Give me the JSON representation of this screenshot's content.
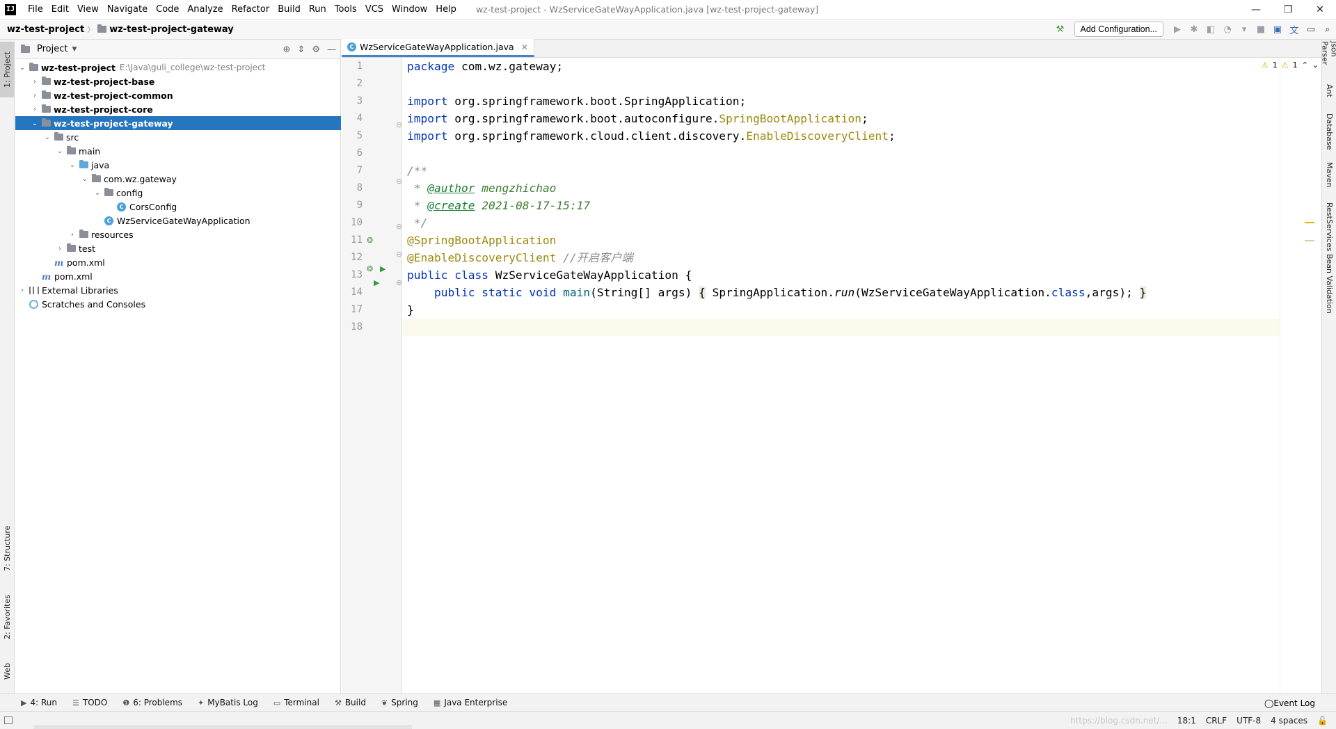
{
  "menubar": {
    "logo": "IJ",
    "items": [
      "File",
      "Edit",
      "View",
      "Navigate",
      "Code",
      "Analyze",
      "Refactor",
      "Build",
      "Run",
      "Tools",
      "VCS",
      "Window",
      "Help"
    ],
    "window_title": "wz-test-project - WzServiceGateWayApplication.java [wz-test-project-gateway]"
  },
  "navbar": {
    "crumbs": [
      "wz-test-project",
      "wz-test-project-gateway"
    ],
    "add_config_label": "Add Configuration..."
  },
  "left_strip": {
    "tabs": [
      "1: Project",
      "7: Structure",
      "2: Favorites",
      "Web"
    ]
  },
  "right_strip": {
    "tabs": [
      "Json Parser",
      "Ant",
      "Database",
      "Maven",
      "RestServices",
      "Bean Validation"
    ]
  },
  "project_panel": {
    "title": "Project",
    "tree": [
      {
        "label": "wz-test-project",
        "hint": "E:\\Java\\guli_college\\wz-test-project",
        "depth": 0,
        "chev": "v",
        "bold": true,
        "icon": "folder"
      },
      {
        "label": "wz-test-project-base",
        "depth": 1,
        "chev": ">",
        "bold": true,
        "icon": "folder"
      },
      {
        "label": "wz-test-project-common",
        "depth": 1,
        "chev": ">",
        "bold": true,
        "icon": "folder"
      },
      {
        "label": "wz-test-project-core",
        "depth": 1,
        "chev": ">",
        "bold": true,
        "icon": "folder"
      },
      {
        "label": "wz-test-project-gateway",
        "depth": 1,
        "chev": "v",
        "bold": true,
        "icon": "folder",
        "selected": true
      },
      {
        "label": "src",
        "depth": 2,
        "chev": "v",
        "icon": "folder"
      },
      {
        "label": "main",
        "depth": 3,
        "chev": "v",
        "icon": "folder"
      },
      {
        "label": "java",
        "depth": 4,
        "chev": "v",
        "icon": "folder-blue"
      },
      {
        "label": "com.wz.gateway",
        "depth": 5,
        "chev": "v",
        "icon": "folder"
      },
      {
        "label": "config",
        "depth": 6,
        "chev": "v",
        "icon": "folder"
      },
      {
        "label": "CorsConfig",
        "depth": 7,
        "chev": "",
        "icon": "class"
      },
      {
        "label": "WzServiceGateWayApplication",
        "depth": 6,
        "chev": "",
        "icon": "class"
      },
      {
        "label": "resources",
        "depth": 4,
        "chev": ">",
        "icon": "folder"
      },
      {
        "label": "test",
        "depth": 3,
        "chev": ">",
        "icon": "folder"
      },
      {
        "label": "pom.xml",
        "depth": 2,
        "chev": "",
        "icon": "maven"
      },
      {
        "label": "pom.xml",
        "depth": 1,
        "chev": "",
        "icon": "maven"
      },
      {
        "label": "External Libraries",
        "depth": 0,
        "chev": ">",
        "icon": "lib"
      },
      {
        "label": "Scratches and Consoles",
        "depth": 0,
        "chev": "",
        "icon": "scratch"
      }
    ]
  },
  "editor": {
    "tab_label": "WzServiceGateWayApplication.java",
    "line_numbers": [
      "1",
      "2",
      "3",
      "4",
      "5",
      "6",
      "7",
      "8",
      "9",
      "10",
      "11",
      "12",
      "13",
      "14",
      "17",
      "18"
    ],
    "code": {
      "l1_kw": "package",
      "l1_rest": " com.wz.gateway;",
      "l3_kw": "import",
      "l3_rest": " org.springframework.boot.SpringApplication;",
      "l4_kw": "import",
      "l4_rest": " org.springframework.boot.autoconfigure.",
      "l4_ann": "SpringBootApplication",
      "l4_end": ";",
      "l5_kw": "import",
      "l5_rest": " org.springframework.cloud.client.discovery.",
      "l5_ann": "EnableDiscoveryClient",
      "l5_end": ";",
      "l7": "/**",
      "l8_pre": " * ",
      "l8_tag": "@author",
      "l8_val": " mengzhichao",
      "l9_pre": " * ",
      "l9_tag": "@create",
      "l9_val": " 2021-08-17-15:17",
      "l10": " */",
      "l11": "@SpringBootApplication",
      "l12_ann": "@EnableDiscoveryClient",
      "l12_cmt": " //开启客户端",
      "l13_kw": "public class",
      "l13_rest": " WzServiceGateWayApplication {",
      "l14_indent": "    ",
      "l14_kw": "public static void",
      "l14_sp": " ",
      "l14_fn": "main",
      "l14_args": "(String[] args) ",
      "l14_ob": "{",
      "l14_a": " SpringApplication.",
      "l14_run": "run",
      "l14_b": "(WzServiceGateWayApplication.",
      "l14_class": "class",
      "l14_c": ",args); ",
      "l14_cb": "}",
      "l17": "}"
    },
    "inspections": {
      "warn1": "1",
      "warn2": "1"
    }
  },
  "bottom_bar": {
    "tools": [
      {
        "icon": "▶",
        "label": "4: Run"
      },
      {
        "icon": "☰",
        "label": "TODO"
      },
      {
        "icon": "❶",
        "label": "6: Problems"
      },
      {
        "icon": "✦",
        "label": "MyBatis Log"
      },
      {
        "icon": "▭",
        "label": "Terminal"
      },
      {
        "icon": "⚒",
        "label": "Build"
      },
      {
        "icon": "❦",
        "label": "Spring"
      },
      {
        "icon": "▦",
        "label": "Java Enterprise"
      }
    ],
    "event_log": "Event Log"
  },
  "status_bar": {
    "url_hint": "https://blog.csdn.net/...",
    "position": "18:1",
    "line_sep": "CRLF",
    "encoding": "UTF-8",
    "indent": "4 spaces"
  },
  "colors": {
    "selection": "#2675bf",
    "keyword": "#0033b3",
    "annotation": "#9e880d"
  }
}
